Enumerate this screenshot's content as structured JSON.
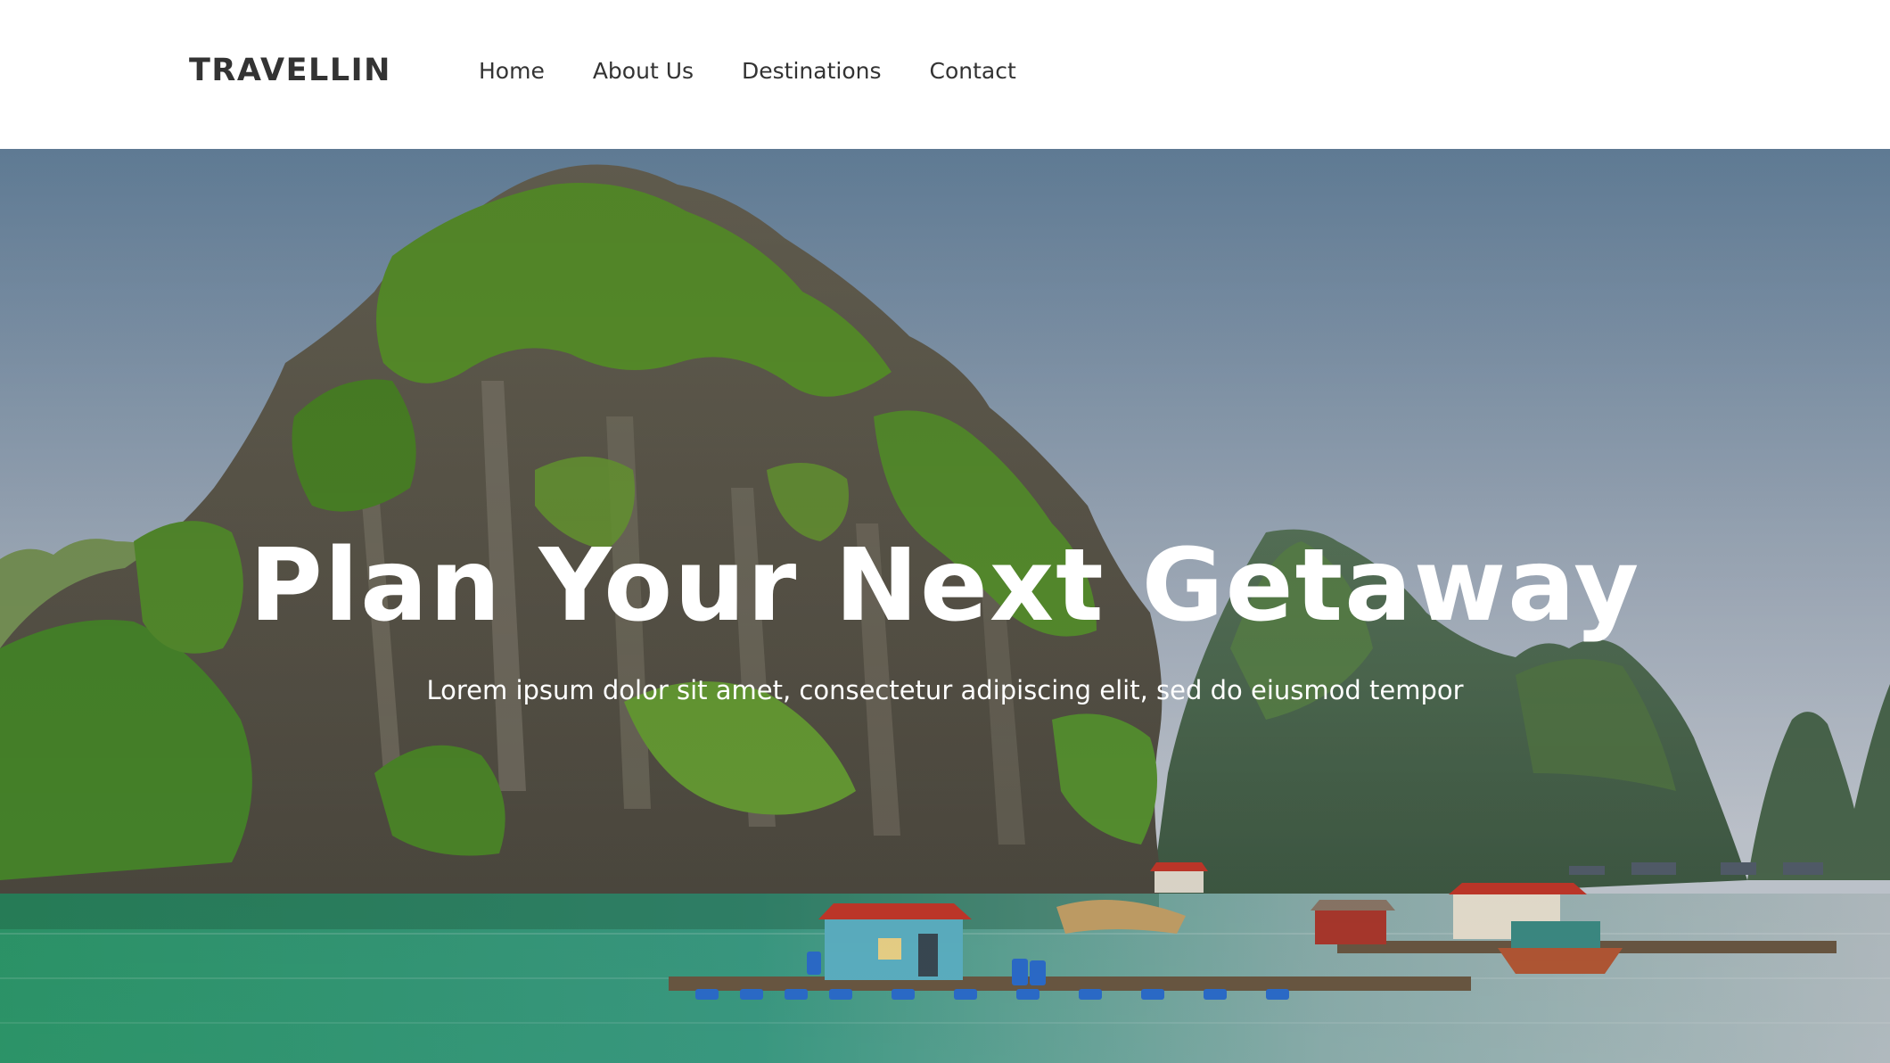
{
  "brand": {
    "logo_text": "TRAVELLIN"
  },
  "nav": {
    "items": [
      {
        "label": "Home"
      },
      {
        "label": "About Us"
      },
      {
        "label": "Destinations"
      },
      {
        "label": "Contact"
      }
    ]
  },
  "hero": {
    "title": "Plan Your Next Getaway",
    "subtitle": "Lorem ipsum dolor sit amet, consectetur adipiscing elit, sed do eiusmod tempor"
  },
  "colors": {
    "nav_bg": "#ffffff",
    "nav_text": "#333333",
    "hero_text": "#ffffff"
  }
}
